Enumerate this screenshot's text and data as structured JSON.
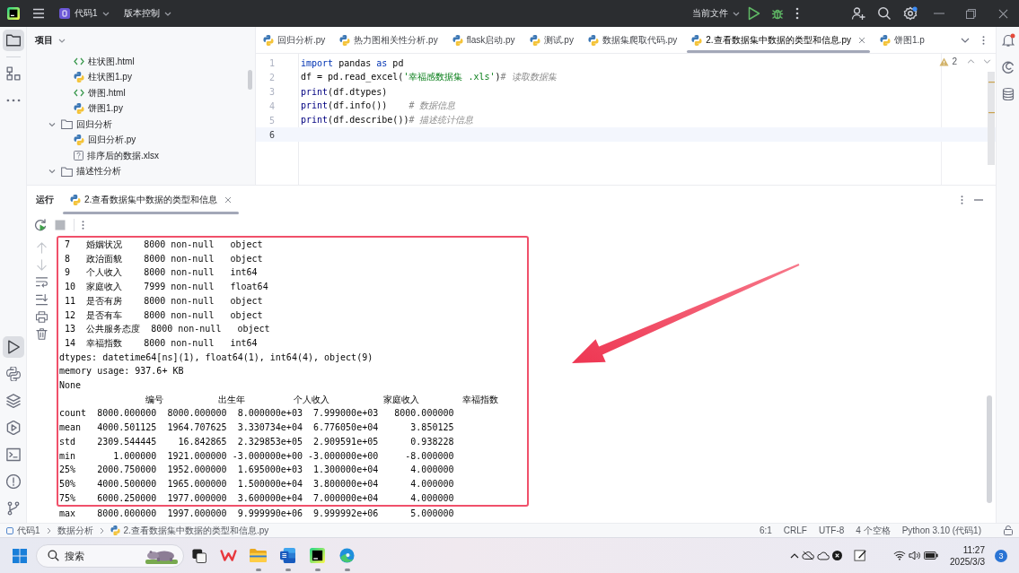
{
  "titlebar": {
    "project": "代码1",
    "vcs": "版本控制",
    "run_config": "当前文件"
  },
  "left_toolbar": {
    "top": [
      {
        "kind": "project",
        "selected": true
      },
      {
        "kind": "structure",
        "selected": false
      },
      {
        "kind": "more",
        "selected": false
      }
    ],
    "bottom": [
      {
        "kind": "run",
        "selected": true
      },
      {
        "kind": "python-packages",
        "selected": false
      },
      {
        "kind": "layers",
        "selected": false
      },
      {
        "kind": "services",
        "selected": false
      },
      {
        "kind": "terminal",
        "selected": false
      },
      {
        "kind": "problems",
        "selected": false
      },
      {
        "kind": "git",
        "selected": false
      }
    ]
  },
  "project_panel": {
    "title": "项目",
    "tree": [
      {
        "children": [
          {
            "name": "柱状图.html",
            "kind": "html"
          },
          {
            "name": "柱状图1.py",
            "kind": "python"
          },
          {
            "name": "饼图.html",
            "kind": "html"
          },
          {
            "name": "饼图1.py",
            "kind": "python"
          }
        ]
      },
      {
        "name": "回归分析",
        "kind": "folder",
        "expanded": true,
        "children": [
          {
            "name": "回归分析.py",
            "kind": "python"
          },
          {
            "name": "排序后的数据.xlsx",
            "kind": "unknown"
          }
        ]
      },
      {
        "name": "描述性分析",
        "kind": "folder",
        "expanded": true
      }
    ]
  },
  "editor": {
    "tabs": [
      {
        "label": "回归分析.py",
        "selected": false
      },
      {
        "label": "热力图相关性分析.py",
        "selected": false
      },
      {
        "label": "flask启动.py",
        "selected": false
      },
      {
        "label": "测试.py",
        "selected": false
      },
      {
        "label": "数据集爬取代码.py",
        "selected": false
      },
      {
        "label": "2.查看数据集中数据的类型和信息.py",
        "selected": true
      },
      {
        "label": "饼图1.p",
        "selected": false
      }
    ],
    "warnings": "2",
    "lines": [
      {
        "number": "1",
        "current": false,
        "tokens": [
          {
            "text": "import",
            "kind": "keyword"
          },
          {
            "text": " pandas ",
            "kind": "plain"
          },
          {
            "text": "as",
            "kind": "keyword"
          },
          {
            "text": " pd",
            "kind": "plain"
          }
        ]
      },
      {
        "number": "2",
        "current": false,
        "tokens": [
          {
            "text": "df = pd.read_excel(",
            "kind": "plain"
          },
          {
            "text": "'幸福感数据集 .xls'",
            "kind": "string"
          },
          {
            "text": ")",
            "kind": "plain"
          },
          {
            "text": "# 读取数据集",
            "kind": "comment"
          }
        ]
      },
      {
        "number": "3",
        "current": false,
        "tokens": [
          {
            "text": "print",
            "kind": "builtin"
          },
          {
            "text": "(df.dtypes)",
            "kind": "plain"
          }
        ]
      },
      {
        "number": "4",
        "current": false,
        "tokens": [
          {
            "text": "print",
            "kind": "builtin"
          },
          {
            "text": "(df.info())    ",
            "kind": "plain"
          },
          {
            "text": "# 数据信息",
            "kind": "comment"
          }
        ]
      },
      {
        "number": "5",
        "current": false,
        "tokens": [
          {
            "text": "print",
            "kind": "builtin"
          },
          {
            "text": "(df.describe())",
            "kind": "plain"
          },
          {
            "text": "# 描述统计信息",
            "kind": "comment"
          }
        ]
      },
      {
        "number": "6",
        "current": true
      }
    ]
  },
  "run_panel": {
    "title": "运行",
    "tabs": [
      {
        "label": "2.查看数据集中数据的类型和信息",
        "selected": true
      }
    ],
    "toolbar": [
      {
        "kind": "rerun",
        "disabled": false
      },
      {
        "kind": "stop",
        "disabled": true
      }
    ],
    "side_tools": [
      {
        "kind": "scroll-up",
        "disabled": true
      },
      {
        "kind": "scroll-down",
        "disabled": true
      },
      {
        "kind": "soft-wrap",
        "disabled": false
      },
      {
        "kind": "scroll-to-end",
        "disabled": false
      },
      {
        "kind": "print",
        "disabled": false
      },
      {
        "kind": "delete",
        "disabled": false
      }
    ],
    "console": {
      "framed_lines": [
        " 7   婚姻状况    8000 non-null   object",
        " 8   政治面貌    8000 non-null   object",
        " 9   个人收入    8000 non-null   int64",
        " 10  家庭收入    7999 non-null   float64",
        " 11  是否有房    8000 non-null   object",
        " 12  是否有车    8000 non-null   object",
        " 13  公共服务态度  8000 non-null   object",
        " 14  幸福指数    8000 non-null   int64",
        "dtypes: datetime64[ns](1), float64(1), int64(4), object(9)",
        "memory usage: 937.6+ KB",
        "None",
        "                编号          出生年         个人收入          家庭收入        幸福指数",
        "count  8000.000000  8000.000000  8.000000e+03  7.999000e+03   8000.000000",
        "mean   4000.501125  1964.707625  3.330734e+04  6.776050e+04      3.850125",
        "std    2309.544445    16.842865  2.329853e+05  2.909591e+05      0.938228",
        "min       1.000000  1921.000000 -3.000000e+00 -3.000000e+00     -8.000000",
        "25%    2000.750000  1952.000000  1.695000e+03  1.300000e+04      4.000000",
        "50%    4000.500000  1965.000000  1.500000e+04  3.800000e+04      4.000000",
        "75%    6000.250000  1977.000000  3.600000e+04  7.000000e+04      4.000000"
      ],
      "lines": [
        "max    8000.000000  1997.000000  9.999990e+06  9.999992e+06      5.000000"
      ]
    }
  },
  "status_bar": {
    "breadcrumbs": [
      {
        "label": "代码1",
        "kind": "project"
      },
      {
        "label": "数据分析",
        "kind": "folder"
      },
      {
        "label": "2.查看数据集中数据的类型和信息.py",
        "kind": "python"
      }
    ],
    "items": [
      "6:1",
      "CRLF",
      "UTF-8",
      "4 个空格",
      "Python 3.10 (代码1)"
    ]
  },
  "taskbar": {
    "search": {
      "placeholder": "搜索"
    },
    "apps": [
      {
        "kind": "task-view",
        "running": false
      },
      {
        "kind": "wps",
        "running": false
      },
      {
        "kind": "explorer",
        "running": true
      },
      {
        "kind": "word",
        "running": true
      },
      {
        "kind": "pycharm",
        "running": true
      },
      {
        "kind": "edge",
        "running": true
      }
    ],
    "clock": {
      "time": "11:27",
      "date": "2025/3/3"
    },
    "notifications": "3"
  }
}
